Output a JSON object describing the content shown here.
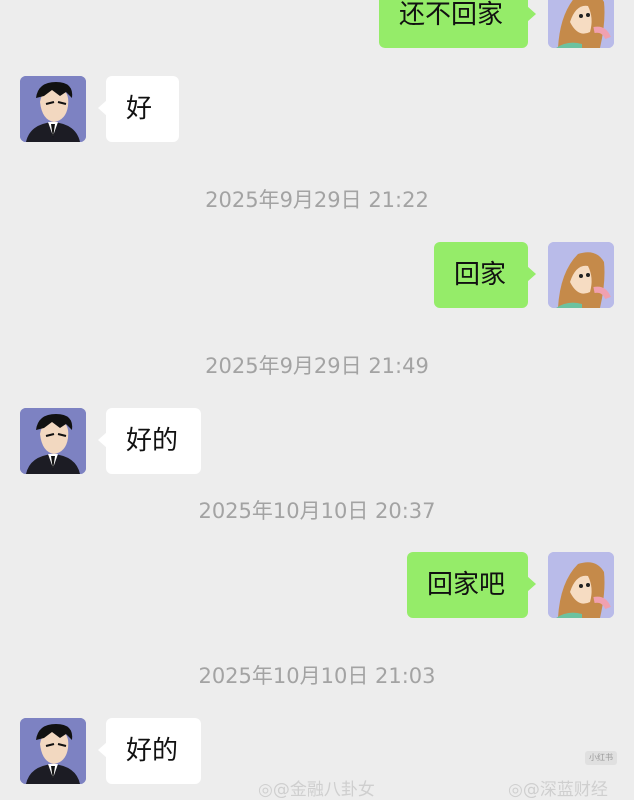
{
  "messages": [
    {
      "side": "right",
      "text": "还不回家"
    },
    {
      "side": "left",
      "text": "好"
    },
    {
      "type": "timestamp",
      "text": "2025年9月29日 21:22"
    },
    {
      "side": "right",
      "text": "回家"
    },
    {
      "type": "timestamp",
      "text": "2025年9月29日 21:49"
    },
    {
      "side": "left",
      "text": "好的"
    },
    {
      "type": "timestamp",
      "text": "2025年10月10日 20:37"
    },
    {
      "side": "right",
      "text": "回家吧"
    },
    {
      "type": "timestamp",
      "text": "2025年10月10日 21:03"
    },
    {
      "side": "left",
      "text": "好的"
    }
  ],
  "watermarks": {
    "left": "@金融八卦女",
    "right": "@深蓝财经",
    "badge": "小红书"
  },
  "colors": {
    "background": "#ededed",
    "sent_bubble": "#95ec69",
    "received_bubble": "#ffffff",
    "timestamp_text": "#a3a3a3"
  }
}
